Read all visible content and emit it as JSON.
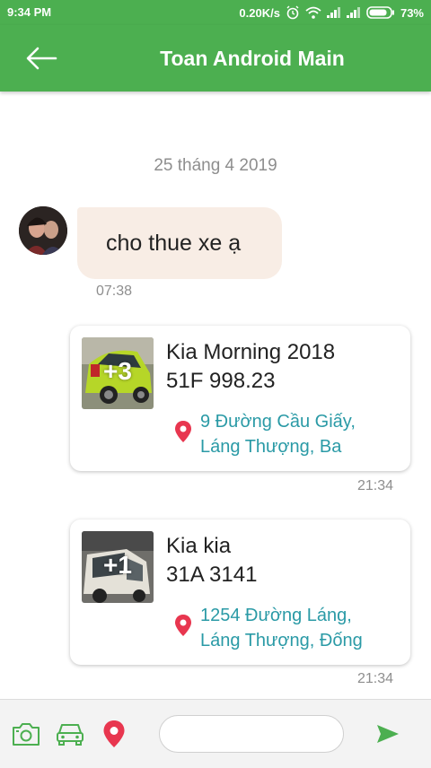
{
  "status_bar": {
    "time": "9:34 PM",
    "net_speed": "0.20K/s",
    "battery": "73%"
  },
  "header": {
    "title": "Toan Android Main",
    "back_icon": "arrow-left-icon",
    "color": "#4caf50"
  },
  "chat": {
    "date_divider": "25 tháng 4 2019",
    "incoming": {
      "text": "cho thue xe ạ",
      "time": "07:38"
    },
    "cards": [
      {
        "photo_count": "+3",
        "name": "Kia Morning 2018",
        "plate": "51F 998.23",
        "address_line1": "9 Đường Cầu Giấy,",
        "address_line2": "Láng Thượng, Ba",
        "time": "21:34"
      },
      {
        "photo_count": "+1",
        "name": "Kia kia",
        "plate": "31A 3141",
        "address_line1": "1254 Đường Láng,",
        "address_line2": "Láng Thượng, Đống",
        "time": "21:34"
      }
    ]
  },
  "composer": {
    "icons": [
      "camera-icon",
      "car-icon",
      "location-pin-icon"
    ],
    "input_value": "",
    "send_icon": "send-icon"
  }
}
